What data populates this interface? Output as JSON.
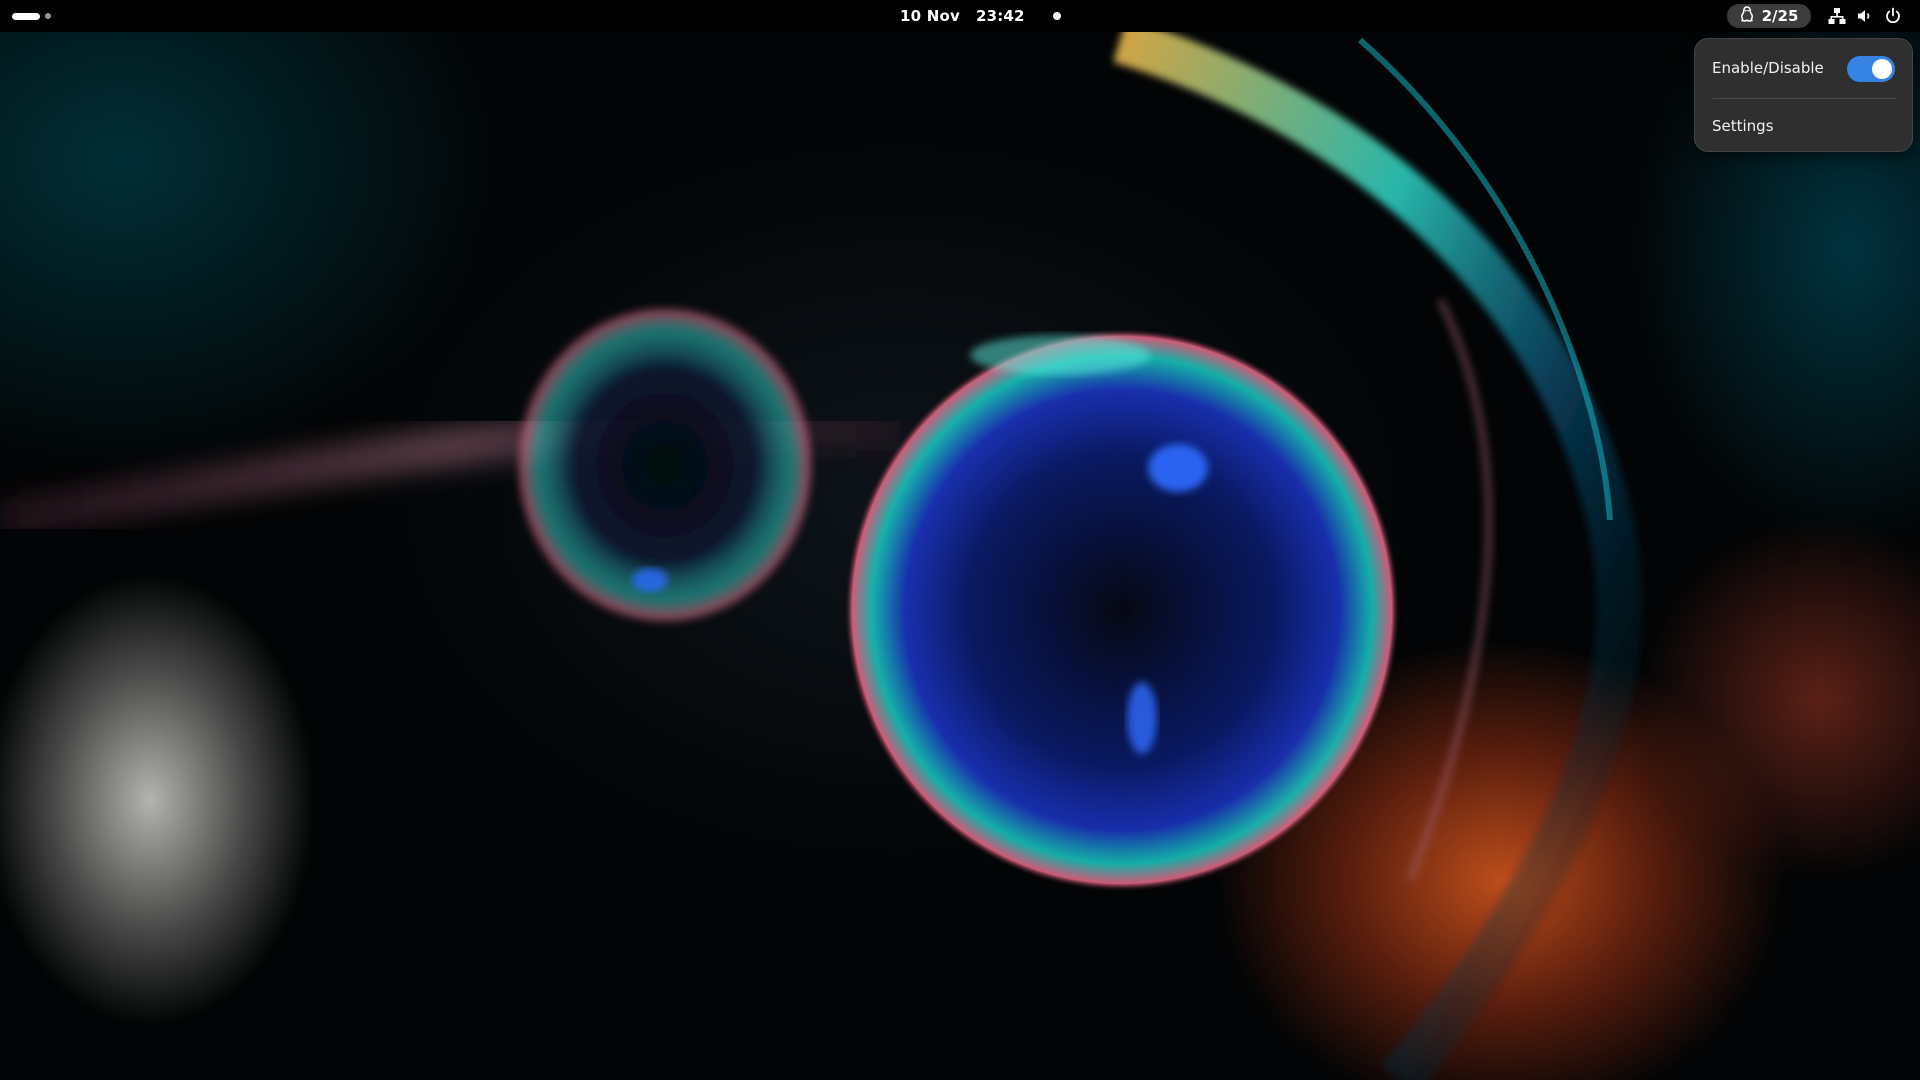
{
  "top_bar": {
    "activities_icon": "workspace-indicator-icon",
    "date": "10 Nov",
    "time": "23:42",
    "notification_icon": "notification-dot-icon",
    "extension_indicator": {
      "icon": "tux-penguin-icon",
      "count": "2/25"
    },
    "status_icons": [
      "network-wired-icon",
      "volume-icon",
      "power-icon"
    ]
  },
  "popup_menu": {
    "toggle_label": "Enable/Disable",
    "toggle_state": true,
    "settings_label": "Settings"
  },
  "colors": {
    "accent": "#3584e4",
    "panel": "#000000",
    "menu_bg": "#2f2f2f",
    "indicator_bg": "#3c3c3c"
  }
}
